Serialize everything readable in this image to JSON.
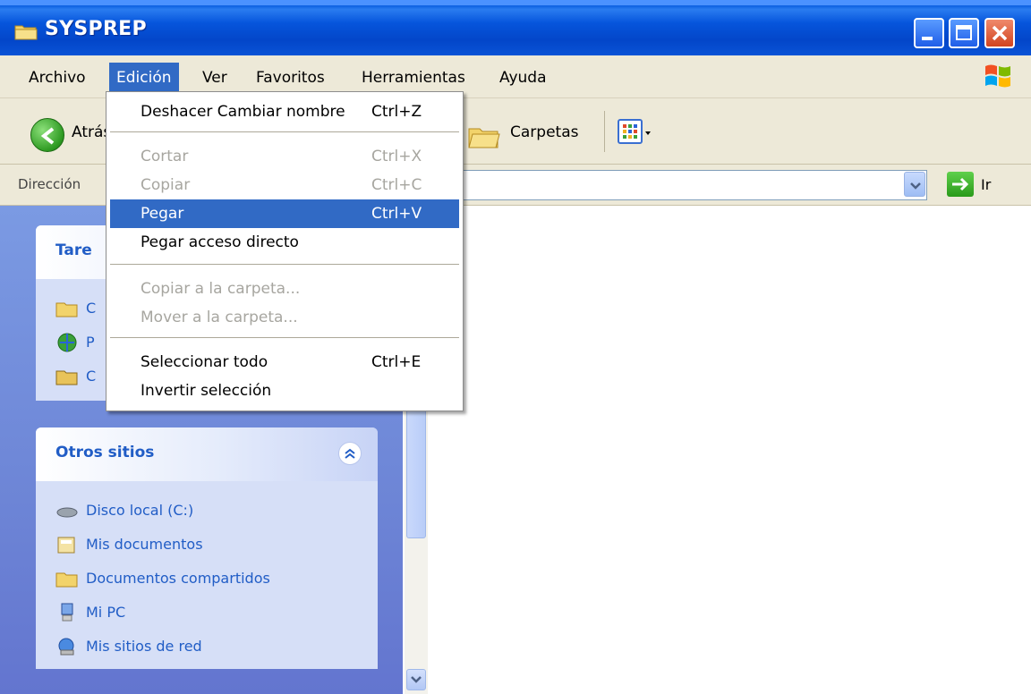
{
  "window": {
    "title": "SYSPREP"
  },
  "menubar": {
    "items": [
      "Archivo",
      "Edición",
      "Ver",
      "Favoritos",
      "Herramientas",
      "Ayuda"
    ],
    "active": "Edición"
  },
  "toolbar": {
    "back_label": "Atrás",
    "folders_label": "Carpetas"
  },
  "addressbar": {
    "label": "Dirección",
    "go_label": "Ir"
  },
  "edit_menu": {
    "items": [
      {
        "label": "Deshacer Cambiar nombre",
        "shortcut": "Ctrl+Z",
        "enabled": true
      },
      {
        "label": "Cortar",
        "shortcut": "Ctrl+X",
        "enabled": false
      },
      {
        "label": "Copiar",
        "shortcut": "Ctrl+C",
        "enabled": false
      },
      {
        "label": "Pegar",
        "shortcut": "Ctrl+V",
        "enabled": true,
        "highlighted": true
      },
      {
        "label": "Pegar acceso directo",
        "shortcut": "",
        "enabled": true
      },
      {
        "label": "Copiar a la carpeta...",
        "shortcut": "",
        "enabled": false
      },
      {
        "label": "Mover a la carpeta...",
        "shortcut": "",
        "enabled": false
      },
      {
        "label": "Seleccionar todo",
        "shortcut": "Ctrl+E",
        "enabled": true
      },
      {
        "label": "Invertir selección",
        "shortcut": "",
        "enabled": true
      }
    ]
  },
  "taskpane": {
    "tasks_title_visible": "Tare",
    "tasks_items_visible": [
      "C",
      "P",
      "C"
    ],
    "other_places": {
      "title": "Otros sitios",
      "items": [
        "Disco local (C:)",
        "Mis documentos",
        "Documentos compartidos",
        "Mi PC",
        "Mis sitios de red"
      ]
    }
  }
}
